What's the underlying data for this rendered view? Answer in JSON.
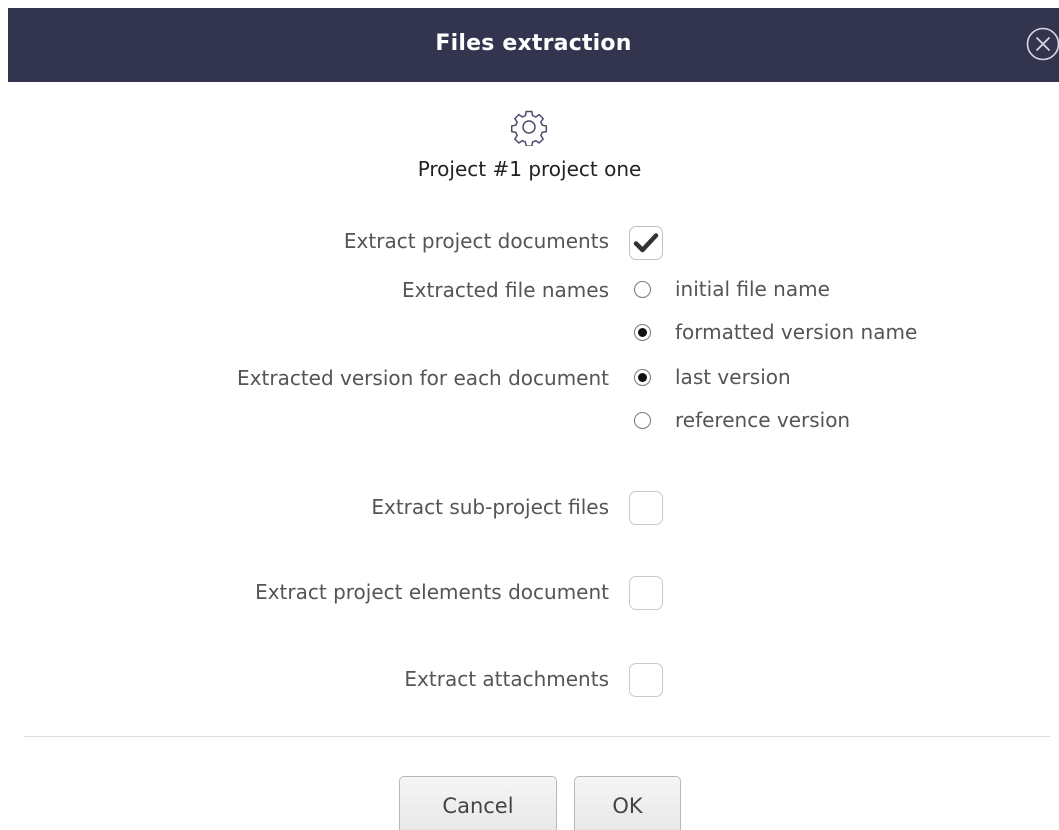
{
  "dialog": {
    "title": "Files extraction",
    "close_icon": "close-circle-icon",
    "header_icon": "gear-icon",
    "project_name": "Project #1 project one"
  },
  "colors": {
    "titlebar_bg": "#33354f",
    "title_text": "#ffffff",
    "label_text": "#555555"
  },
  "options": {
    "extract_project_documents": {
      "label": "Extract project documents",
      "checked": true
    },
    "extracted_file_names": {
      "label": "Extracted file names",
      "choices": [
        "initial file name",
        "formatted version name"
      ],
      "selected": "formatted version name"
    },
    "extracted_version": {
      "label": "Extracted version for each document",
      "choices": [
        "last version",
        "reference version"
      ],
      "selected": "last version"
    },
    "extract_subproject_files": {
      "label": "Extract sub-project files",
      "checked": false
    },
    "extract_project_elements_document": {
      "label": "Extract project elements document",
      "checked": false
    },
    "extract_attachments": {
      "label": "Extract attachments",
      "checked": false
    }
  },
  "buttons": {
    "cancel": "Cancel",
    "ok": "OK"
  }
}
